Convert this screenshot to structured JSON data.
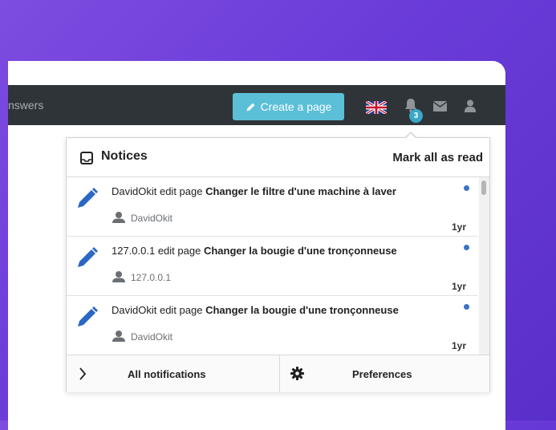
{
  "navbar": {
    "answers_label": "nswers",
    "create_button_label": "Create a page",
    "notification_count": "3"
  },
  "notices_panel": {
    "title": "Notices",
    "mark_all_read_label": "Mark all as read",
    "items": [
      {
        "actor": "DavidOkit",
        "action": " edit page ",
        "page": "Changer le filtre d'une machine à laver",
        "author": "DavidOkit",
        "age": "1yr",
        "unread": true
      },
      {
        "actor": "127.0.0.1",
        "action": " edit page ",
        "page": "Changer la bougie d'une tronçonneuse",
        "author": "127.0.0.1",
        "age": "1yr",
        "unread": true
      },
      {
        "actor": "DavidOkit",
        "action": " edit page ",
        "page": "Changer la bougie d'une tronçonneuse",
        "author": "DavidOkit",
        "age": "1yr",
        "unread": true
      }
    ],
    "footer": {
      "all_notifications_label": "All notifications",
      "preferences_label": "Preferences"
    }
  },
  "icons": [
    "pencil-icon",
    "edit-icon",
    "uk-flag-icon",
    "bell-icon",
    "mail-icon",
    "user-icon",
    "inbox-icon",
    "person-icon",
    "chevron-right-icon",
    "gear-icon"
  ],
  "colors": {
    "background_gradient_start": "#7d4ce0",
    "background_gradient_end": "#5a2fc9",
    "navbar": "#2f3438",
    "create_button": "#5bbfd8",
    "unread_dot": "#3a73c8",
    "pencil_icon": "#2b67c4"
  }
}
